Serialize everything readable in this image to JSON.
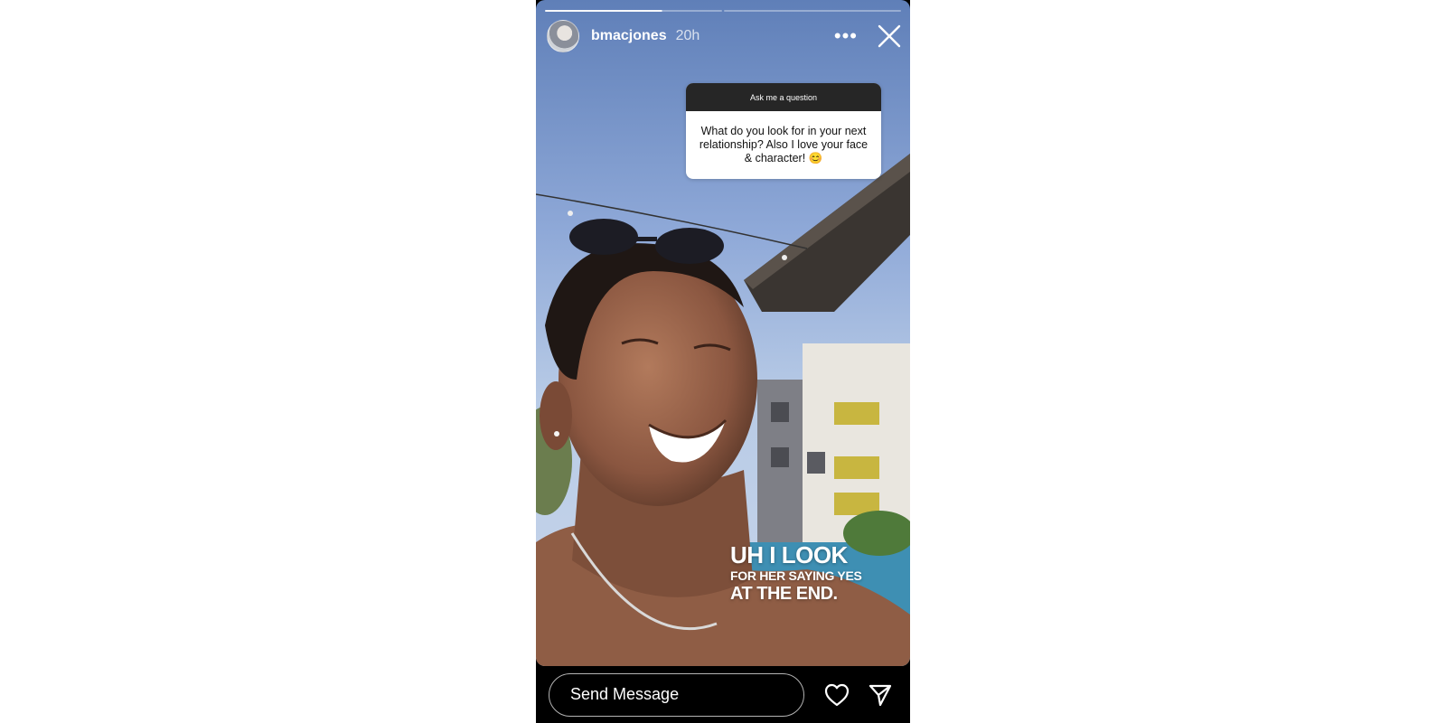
{
  "story": {
    "progress_total": 2,
    "progress_filled_fraction": 0.66,
    "username": "bmacjones",
    "time_ago": "20h",
    "more_icon": "more-horizontal-icon",
    "close_icon": "close-icon"
  },
  "question_sticker": {
    "header": "Ask me a question",
    "question": "What do you look for in your next relationship? Also I love your face & character! 😊"
  },
  "caption": {
    "line1": "UH I LOOK",
    "line2": "FOR HER SAYING YES",
    "line3": "AT THE END."
  },
  "footer": {
    "message_placeholder": "Send Message",
    "like_icon": "heart-icon",
    "share_icon": "send-icon"
  },
  "colors": {
    "background": "#ffffff",
    "story_bg": "#000000",
    "sticker_header": "#262626"
  }
}
